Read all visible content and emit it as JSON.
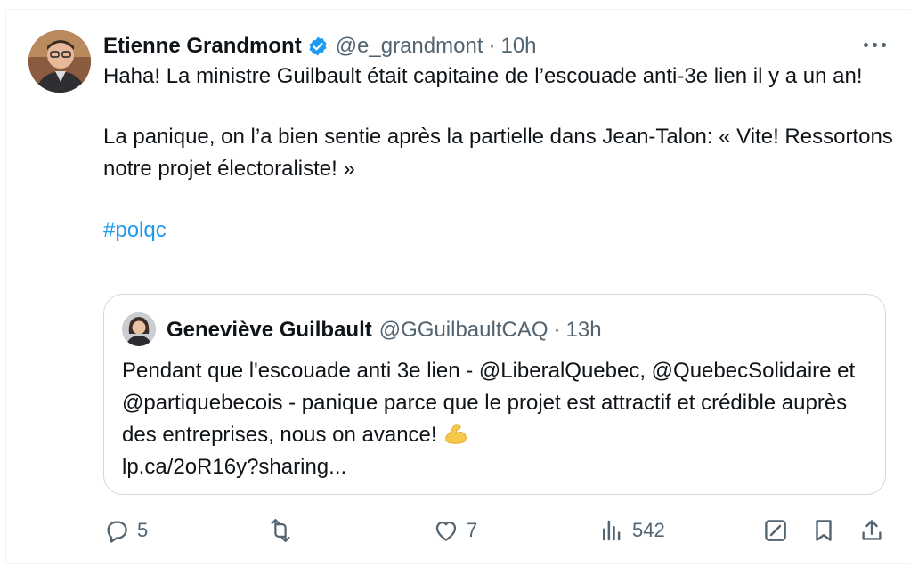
{
  "tweet": {
    "author_name": "Etienne Grandmont",
    "handle": "@e_grandmont",
    "separator": "·",
    "time": "10h",
    "paragraphs": [
      "Haha! La ministre Guilbault était capitaine de  l’escouade anti-3e lien il y a un an!",
      "La panique, on l’a bien sentie après la partielle dans Jean-Talon: « Vite! Ressortons notre projet électoraliste! »"
    ],
    "hashtag": "#polqc"
  },
  "quoted": {
    "author_name": "Geneviève Guilbault",
    "handle": "@GGuilbaultCAQ",
    "separator": "·",
    "time": "13h",
    "text": "Pendant que l'escouade anti 3e lien - @LiberalQuebec, @QuebecSolidaire et @partiquebecois - panique parce que le projet est attractif et crédible auprès des entreprises, nous on avance!",
    "emoji": "flexed-biceps",
    "link": "lp.ca/2oR16y?sharing..."
  },
  "actions": {
    "replies": "5",
    "reposts": "",
    "likes": "7",
    "views": "542"
  },
  "colors": {
    "accent": "#1d9bf0",
    "secondary_text": "#536471",
    "border": "#cfd9de"
  },
  "icons": [
    "verified-badge-icon",
    "more-icon",
    "reply-icon",
    "repost-icon",
    "like-icon",
    "views-icon",
    "grok-icon",
    "bookmark-icon",
    "share-icon"
  ]
}
